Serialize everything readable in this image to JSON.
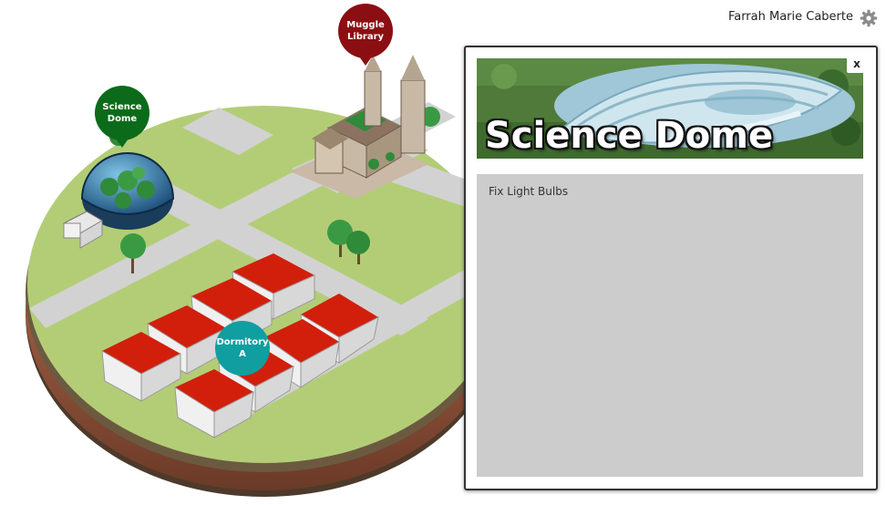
{
  "header": {
    "user_name": "Farrah Marie Caberte",
    "settings_icon": "gear-icon"
  },
  "map": {
    "markers": [
      {
        "line1": "Science",
        "line2": "Dome",
        "color": "#0b6b1a"
      },
      {
        "line1": "Muggle",
        "line2": "Library",
        "color": "#8b0f12"
      },
      {
        "line1": "Dormitory",
        "line2": "A",
        "color": "#119ea0"
      }
    ]
  },
  "panel": {
    "title": "Science Dome",
    "close_label": "x",
    "tasks": [
      {
        "label": "Fix Light Bulbs"
      }
    ]
  }
}
